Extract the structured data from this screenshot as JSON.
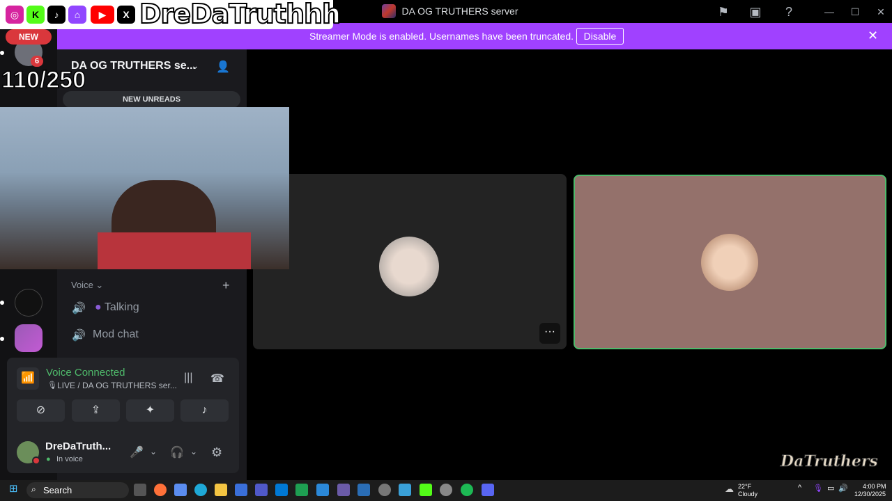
{
  "window": {
    "title": "DA OG TRUTHERS server"
  },
  "overlay": {
    "brand": "DreDaTruthhh",
    "new_badge": "NEW",
    "server_badge": "6",
    "counter": "110/250",
    "watermark": "DaTruthers"
  },
  "banner": {
    "message": "Streamer Mode is enabled. Usernames have been truncated.",
    "disable_label": "Disable"
  },
  "channels": {
    "server_name": "DA OG TRUTHERS se...",
    "new_unreads": "NEW UNREADS",
    "category": "Voice",
    "items": [
      {
        "label": "Talking"
      },
      {
        "label": "Mod chat"
      }
    ]
  },
  "voice": {
    "title": "Voice Connected",
    "subtitle": "LIVE / DA OG TRUTHERS ser..."
  },
  "user": {
    "name": "DreDaTruth...",
    "status": "In voice"
  },
  "taskbar": {
    "search_label": "Search",
    "weather_temp": "22°F",
    "weather_desc": "Cloudy",
    "time": "4:00 PM",
    "date": "12/30/2025"
  },
  "colors": {
    "accent_purple": "#a041ff",
    "voice_green": "#4fba6b",
    "new_red": "#da373c"
  }
}
